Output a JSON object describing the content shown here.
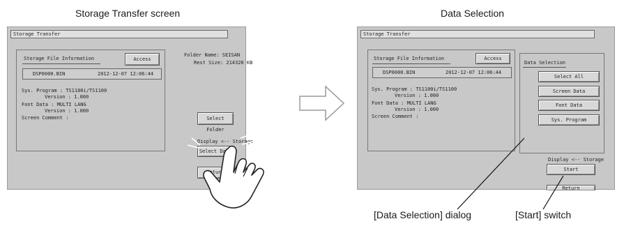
{
  "captions": {
    "left_title": "Storage Transfer screen",
    "right_title": "Data Selection",
    "callout_dialog": "[Data Selection] dialog",
    "callout_start": "[Start] switch"
  },
  "left_screen": {
    "title": "Storage Transfer",
    "info_header": "Storage File Information",
    "access_button": "Access",
    "file_name": "DSP0000.BIN",
    "file_datetime": "2012-12-07  12:06:44",
    "sys_program_line": "Sys. Program   : TS1100i/TS1100",
    "sys_version_line": "Version : 1.000",
    "font_data_line": "Font Data      : MULTI LANG",
    "font_version_line": "Version : 1.000",
    "screen_comment_line": "Screen Comment :",
    "folder_name_line": "Folder Name: SEISAN",
    "rest_size_line": "Rest Size:  214320 KB",
    "select_folder_button": "Select Folder",
    "direction_label": "Display <-- Storage",
    "select_data_button": "Select Data",
    "return_button": "Return"
  },
  "right_screen": {
    "title": "Storage Transfer",
    "info_header": "Storage File Information",
    "access_button": "Access",
    "file_name": "DSP0000.BIN",
    "file_datetime": "2012-12-07  12:06:44",
    "sys_program_line": "Sys. Program   : TS1100i/TS1100",
    "sys_version_line": "Version : 1.000",
    "font_data_line": "Font Data      : MULTI LANG",
    "font_version_line": "Version : 1.000",
    "screen_comment_line": "Screen Comment :",
    "data_selection_header": "Data Selection",
    "select_all_button": "Select All",
    "screen_data_button": "Screen Data",
    "font_data_button": "Font Data",
    "sys_program_button": "Sys. Program",
    "direction_label": "Display <-- Storage",
    "start_button": "Start",
    "return_button": "Return"
  }
}
